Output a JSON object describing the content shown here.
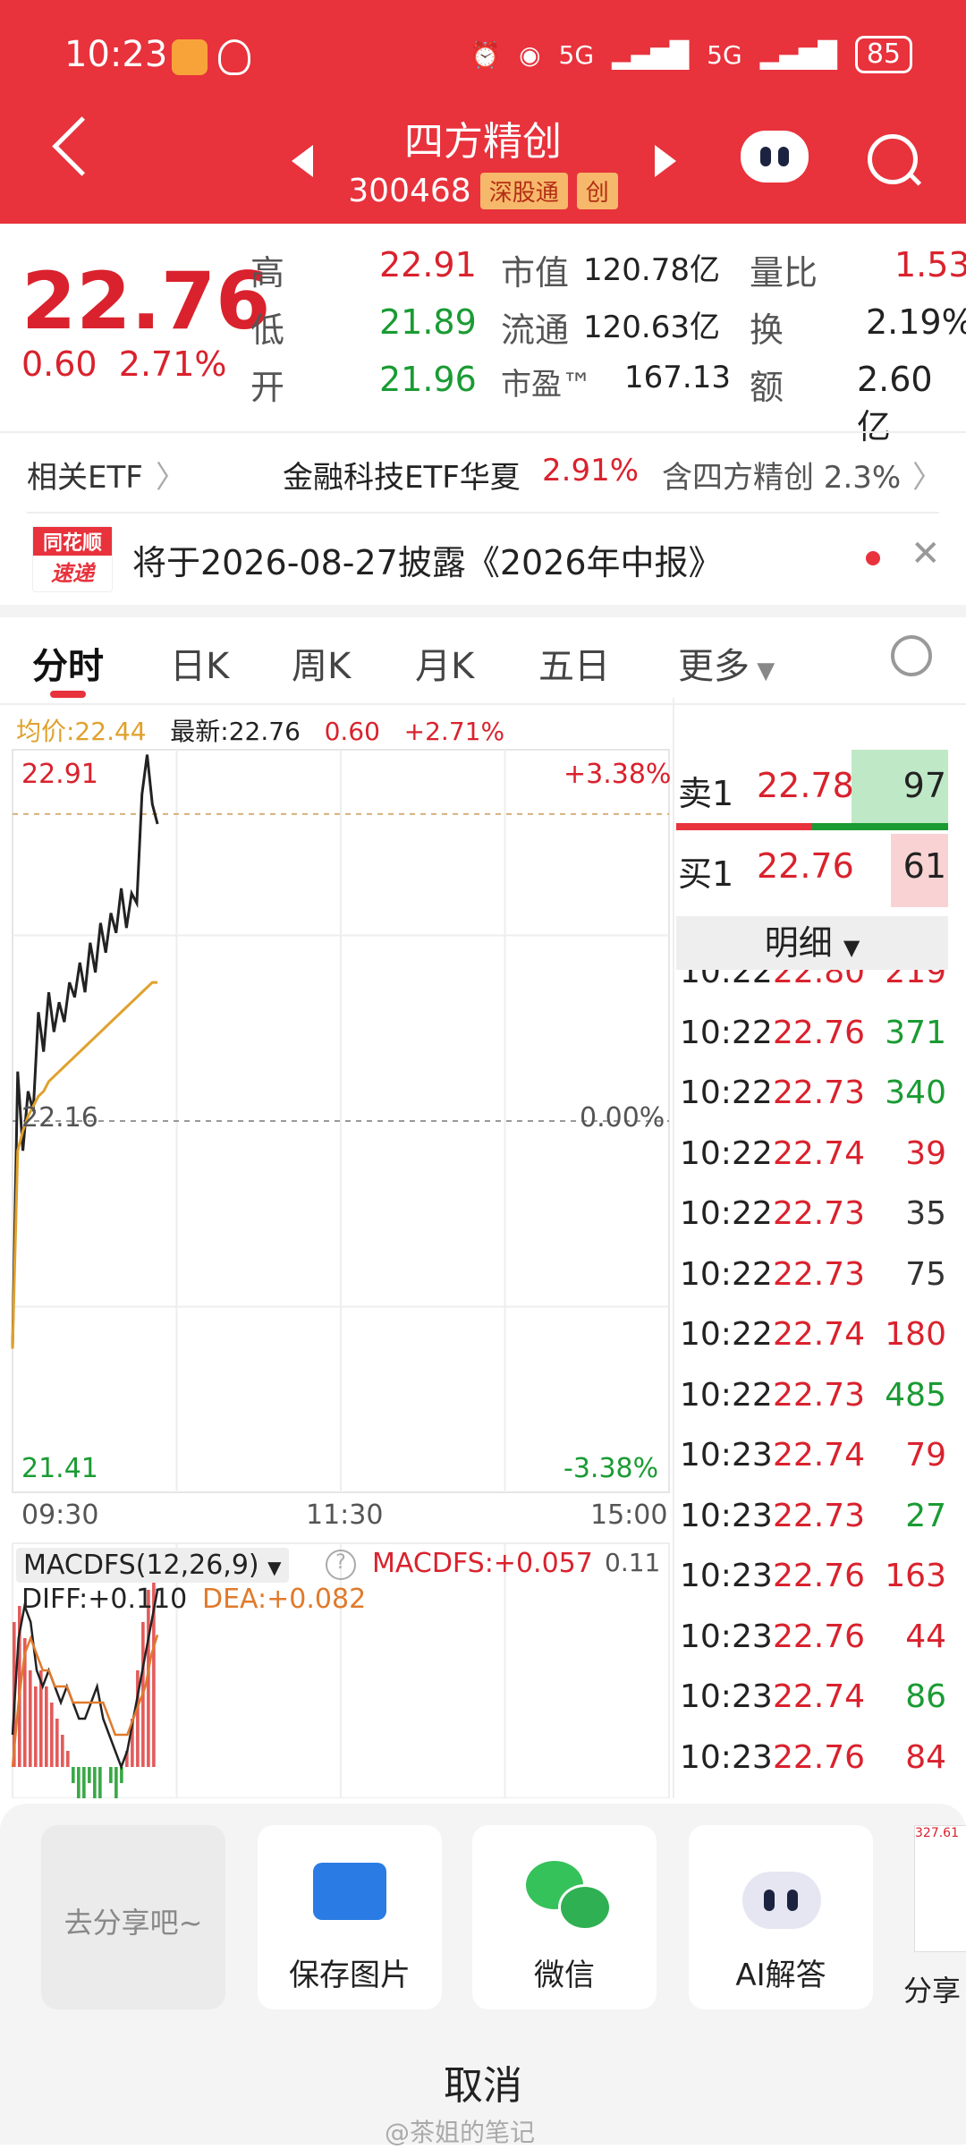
{
  "status": {
    "time": "10:23",
    "signal_5g_a": "5G",
    "signal_5g_b": "5G",
    "battery": "85"
  },
  "header": {
    "title": "四方精创",
    "code": "300468",
    "tag_connect": "深股通",
    "tag_board": "创"
  },
  "quote": {
    "price": "22.76",
    "change": "0.60",
    "change_pct": "2.71%",
    "high_label": "高",
    "high": "22.91",
    "low_label": "低",
    "low": "21.89",
    "open_label": "开",
    "open": "21.96",
    "mktcap_label": "市值",
    "mktcap": "120.78亿",
    "float_label": "流通",
    "float": "120.63亿",
    "pe_label": "市盈™",
    "pe": "167.13",
    "volratio_label": "量比",
    "volratio": "1.53",
    "turnover_label": "换",
    "turnover": "2.19%",
    "amount_label": "额",
    "amount": "2.60亿"
  },
  "etf": {
    "label": "相关ETF",
    "name": "金融科技ETF华夏",
    "pct": "2.91%",
    "contain": "含四方精创 2.3%"
  },
  "notice": {
    "logo_top": "同花顺",
    "logo_bottom": "速递",
    "text": "将于2026-08-27披露《2026年中报》"
  },
  "tabs": [
    "分时",
    "日K",
    "周K",
    "月K",
    "五日",
    "更多"
  ],
  "chart_info": {
    "avg": "均价:22.44",
    "latest": "最新:22.76",
    "chg": "0.60",
    "pct": "+2.71%"
  },
  "chart_data": {
    "type": "line",
    "x_labels": [
      "09:30",
      "11:30",
      "15:00"
    ],
    "y_labels_left": [
      "22.91",
      "22.16",
      "21.41"
    ],
    "y_labels_right": [
      "+3.38%",
      "0.00%",
      "-3.38%"
    ],
    "ylim": [
      21.41,
      22.91
    ],
    "prev_close": 22.16,
    "series": [
      {
        "values": [
          21.7,
          22.26,
          22.1,
          22.22,
          22.18,
          22.38,
          22.3,
          22.42,
          22.34,
          22.4,
          22.36,
          22.44,
          22.41,
          22.48,
          22.42,
          22.52,
          22.46,
          22.56,
          22.5,
          22.58,
          22.54,
          22.63,
          22.55,
          22.62,
          22.6,
          22.82,
          22.9,
          22.8,
          22.76
        ],
        "color": "#222222"
      },
      {
        "values": [
          21.7,
          22.1,
          22.14,
          22.17,
          22.19,
          22.21,
          22.22,
          22.24,
          22.25,
          22.26,
          22.27,
          22.28,
          22.29,
          22.3,
          22.31,
          22.32,
          22.33,
          22.34,
          22.35,
          22.36,
          22.37,
          22.38,
          22.39,
          22.4,
          22.41,
          22.42,
          22.43,
          22.44,
          22.44
        ],
        "color": "#e0a12c"
      }
    ]
  },
  "macd": {
    "title": "MACDFS(12,26,9)",
    "value_label": "MACDFS:+0.057",
    "right_scale": "0.11",
    "diff": "DIFF:+0.110",
    "dea": "DEA:+0.082",
    "bars": [
      0.09,
      0.1,
      0.08,
      0.06,
      0.05,
      0.06,
      0.05,
      0.04,
      0.03,
      0.02,
      0.01,
      -0.01,
      -0.02,
      -0.02,
      -0.01,
      -0.02,
      -0.02,
      0.0,
      -0.01,
      -0.02,
      -0.01,
      0.01,
      0.03,
      0.06,
      0.09,
      0.11,
      0.12
    ],
    "diff_line": [
      0.02,
      0.08,
      0.1,
      0.09,
      0.06,
      0.05,
      0.06,
      0.05,
      0.04,
      0.05,
      0.04,
      0.03,
      0.03,
      0.04,
      0.05,
      0.03,
      0.02,
      0.01,
      0.0,
      0.01,
      0.03,
      0.05,
      0.07,
      0.09,
      0.11
    ],
    "dea_line": [
      0.0,
      0.04,
      0.07,
      0.08,
      0.07,
      0.06,
      0.06,
      0.05,
      0.05,
      0.05,
      0.04,
      0.04,
      0.04,
      0.04,
      0.04,
      0.04,
      0.03,
      0.02,
      0.02,
      0.02,
      0.03,
      0.04,
      0.05,
      0.07,
      0.082
    ]
  },
  "orderbook": {
    "sell_label": "卖1",
    "sell_price": "22.78",
    "sell_vol": "97",
    "buy_label": "买1",
    "buy_price": "22.76",
    "buy_vol": "61",
    "detail_label": "明细"
  },
  "ticks": [
    {
      "t": "10:22",
      "p": "22.80",
      "v": "219",
      "c": "red"
    },
    {
      "t": "10:22",
      "p": "22.76",
      "v": "371",
      "c": "green"
    },
    {
      "t": "10:22",
      "p": "22.73",
      "v": "340",
      "c": "green"
    },
    {
      "t": "10:22",
      "p": "22.74",
      "v": "39",
      "c": "red"
    },
    {
      "t": "10:22",
      "p": "22.73",
      "v": "35",
      "c": "gray"
    },
    {
      "t": "10:22",
      "p": "22.73",
      "v": "75",
      "c": "gray"
    },
    {
      "t": "10:22",
      "p": "22.74",
      "v": "180",
      "c": "red"
    },
    {
      "t": "10:22",
      "p": "22.73",
      "v": "485",
      "c": "green"
    },
    {
      "t": "10:23",
      "p": "22.74",
      "v": "79",
      "c": "red"
    },
    {
      "t": "10:23",
      "p": "22.73",
      "v": "27",
      "c": "green"
    },
    {
      "t": "10:23",
      "p": "22.76",
      "v": "163",
      "c": "red"
    },
    {
      "t": "10:23",
      "p": "22.76",
      "v": "44",
      "c": "red"
    },
    {
      "t": "10:23",
      "p": "22.74",
      "v": "86",
      "c": "green"
    },
    {
      "t": "10:23",
      "p": "22.76",
      "v": "84",
      "c": "red"
    }
  ],
  "share": {
    "placeholder": "去分享吧~",
    "save": "保存图片",
    "wechat": "微信",
    "ai": "AI解答",
    "more": "分享",
    "preview_value": "327.61",
    "cancel": "取消"
  },
  "watermark": "@茶姐的笔记"
}
